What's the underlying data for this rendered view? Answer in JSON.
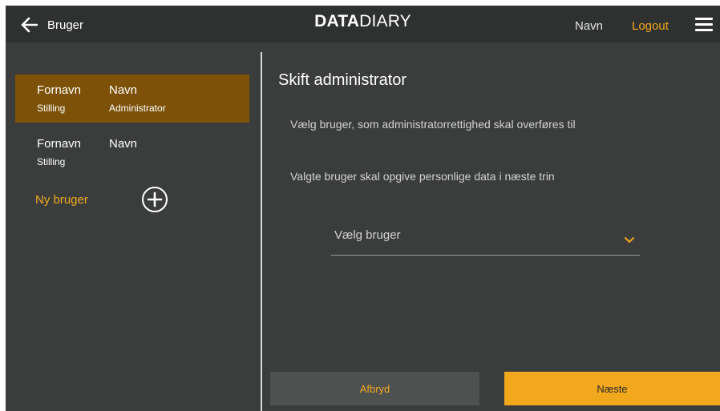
{
  "header": {
    "back_label": "Bruger",
    "brand_bold": "DATA",
    "brand_light": "DIARY",
    "user_name": "Navn",
    "logout_label": "Logout"
  },
  "sidebar": {
    "users": [
      {
        "first_name": "Fornavn",
        "last_name": "Navn",
        "position": "Stilling",
        "role": "Administrator",
        "selected": true
      },
      {
        "first_name": "Fornavn",
        "last_name": "Navn",
        "position": "Stilling",
        "role": "",
        "selected": false
      }
    ],
    "new_user_label": "Ny bruger"
  },
  "main": {
    "title": "Skift administrator",
    "description_1": "Vælg bruger, som administratorrettighed skal overføres til",
    "description_2": "Valgte bruger skal opgive personlige data i næste trin",
    "select_placeholder": "Vælg bruger"
  },
  "footer": {
    "cancel_label": "Afbryd",
    "next_label": "Næste"
  },
  "colors": {
    "accent": "#f2a81d",
    "selected_row": "#7d5208",
    "background": "#3b3d3c",
    "topbar": "#2f3130"
  },
  "icons": {
    "back": "arrow-left-icon",
    "menu": "hamburger-menu-icon",
    "add": "plus-circle-icon",
    "dropdown": "chevron-down-icon"
  }
}
